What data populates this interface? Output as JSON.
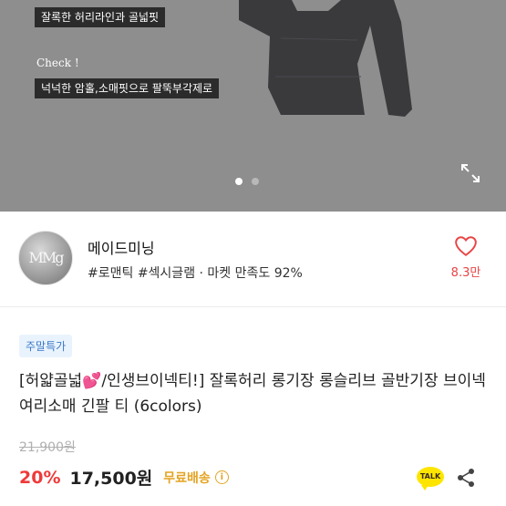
{
  "hero": {
    "caption_top": "잘록한 허리라인과 골넓핏",
    "check_label": "Check !",
    "caption_bottom": "넉넉한 암홀,소매핏으로 팔뚝부각제로",
    "slide_count": 2,
    "active_slide": 1
  },
  "seller": {
    "avatar_text": "MMg",
    "name": "메이드미닝",
    "tags": "#로맨틱 #섹시글램 · 마켓 만족도 92%",
    "likes": "8.3만"
  },
  "product": {
    "badge": "주말특가",
    "title": "[허얇골넓💕/인생브이넥티!] 잘록허리 롱기장 롱슬리브 골반기장 브이넥 여리소매 긴팔 티 (6colors)",
    "original_price": "21,900원",
    "discount": "20%",
    "price": "17,500원",
    "shipping": "무료배송",
    "info_symbol": "i",
    "talk_label": "TALK"
  },
  "colors": {
    "hero_bg": "#8e8e8e",
    "garment": "#3a3a3d",
    "discount": "#ef3a3a",
    "shipping": "#e3a423",
    "like": "#e84545",
    "badge_bg": "#e9f3fd",
    "badge_text": "#3b78c7",
    "talk_bg": "#fee500"
  },
  "icons": {
    "expand": "expand-icon",
    "heart": "heart-icon",
    "share": "share-icon",
    "info": "info-icon",
    "talk": "kakaotalk-icon"
  }
}
